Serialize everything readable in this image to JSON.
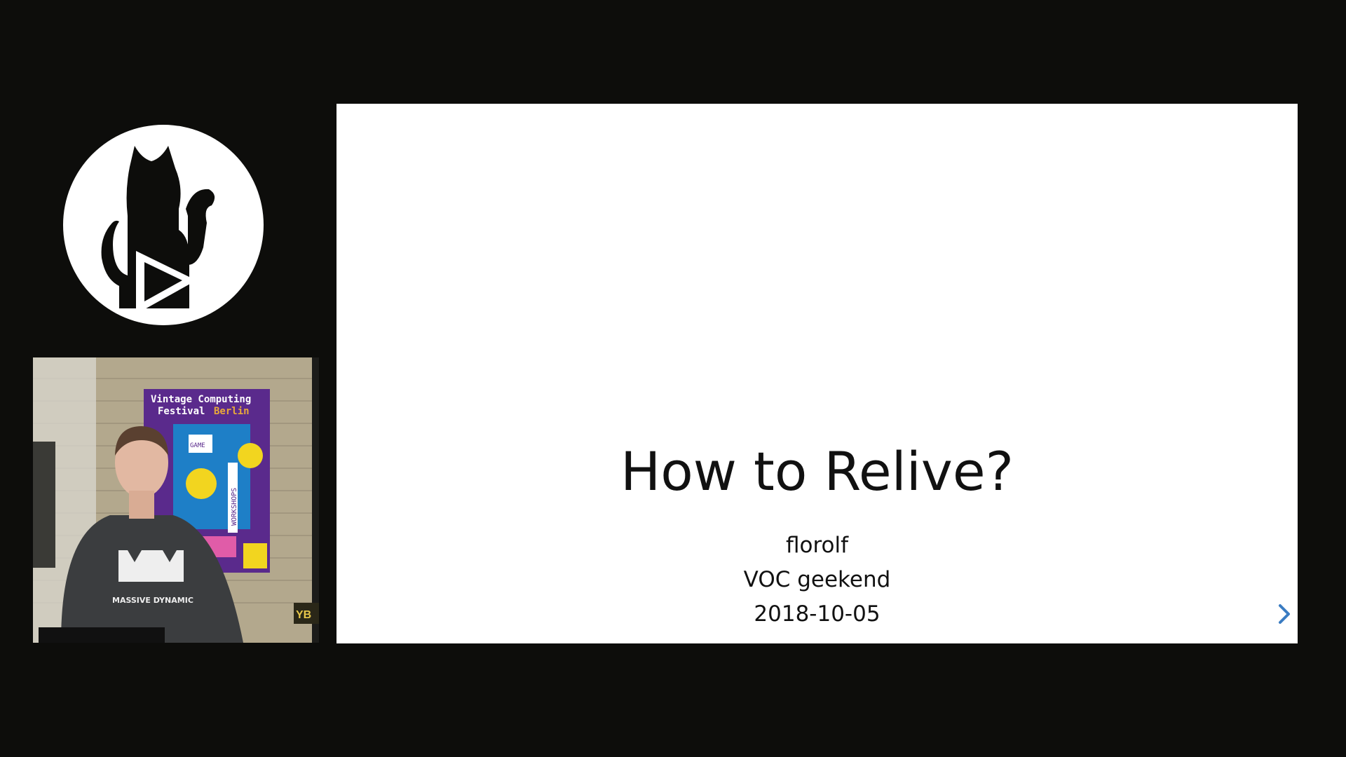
{
  "logo": {
    "icon": "cat-play-icon"
  },
  "camera": {
    "poster_line1": "Vintage Computing",
    "poster_line2_a": "Festival",
    "poster_line2_b": "Berlin",
    "poster_game": "GAME",
    "poster_workshops": "WORKSHOPS",
    "shirt_text": "MASSIVE DYNAMIC",
    "colors": {
      "poster_bg": "#5a2a8c",
      "poster_yellow": "#f2d51f",
      "wall": "#b4a98f"
    }
  },
  "slide": {
    "title": "How to Relive?",
    "lines": [
      "florolf",
      "VOC geekend",
      "2018-10-05"
    ],
    "next_icon": "chevron-right-icon",
    "colors": {
      "background": "#ffffff",
      "text": "#111111",
      "accent": "#3a7cc2"
    }
  }
}
